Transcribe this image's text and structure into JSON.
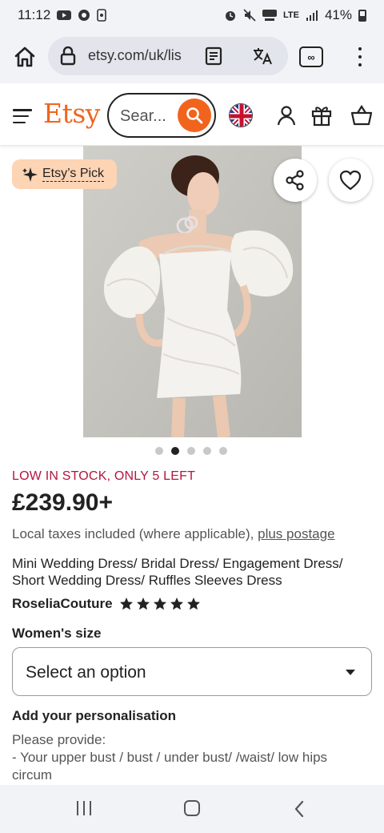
{
  "status_bar": {
    "time": "11:12",
    "network": "LTE",
    "battery": "41%"
  },
  "browser": {
    "url": "etsy.com/uk/lis",
    "tabs_count": "∞"
  },
  "header": {
    "logo": "Etsy",
    "search_placeholder": "Sear..."
  },
  "badge": {
    "label": "Etsy’s Pick"
  },
  "carousel": {
    "count": 5,
    "active_index": 1
  },
  "product": {
    "stock_notice": "LOW IN STOCK, ONLY 5 LEFT",
    "price": "£239.90+",
    "taxes_text": "Local taxes included (where applicable), ",
    "postage_link": "plus postage",
    "title": "Mini Wedding Dress/ Bridal Dress/ Engagement Dress/ Short Wedding Dress/ Ruffles Sleeves Dress",
    "shop_name": "RoseliaCouture",
    "rating": 5
  },
  "options": {
    "size_label": "Women's size",
    "size_select": "Select an option",
    "personalisation_label": "Add your personalisation",
    "personalisation_line1": "Please provide:",
    "personalisation_line2": "- Your upper bust / bust / under bust/ /waist/ low hips",
    "personalisation_line3": "circum"
  },
  "colors": {
    "etsy_orange": "#f1641e",
    "stock_red": "#b4153d",
    "badge_bg": "#fdd4b4"
  }
}
